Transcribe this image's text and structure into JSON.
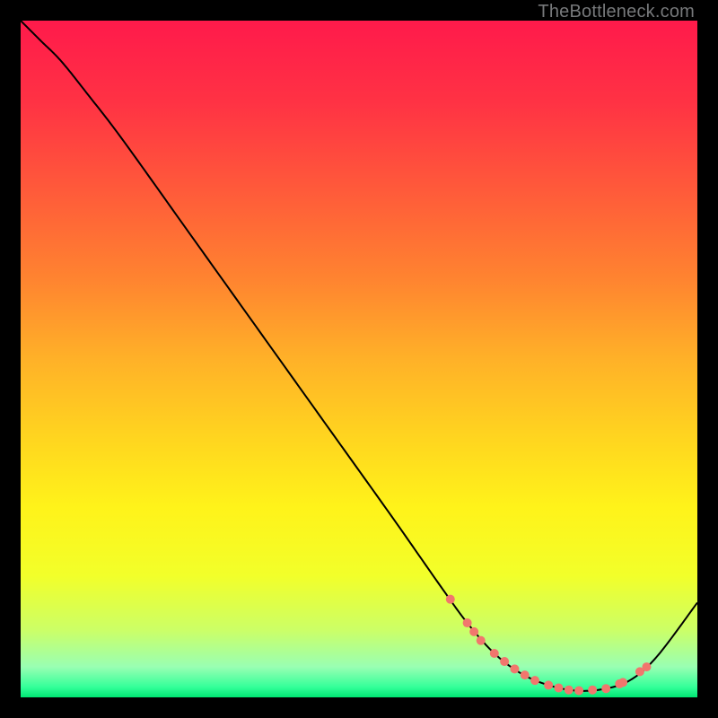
{
  "attribution": "TheBottleneck.com",
  "chart_data": {
    "type": "line",
    "title": "",
    "xlabel": "",
    "ylabel": "",
    "xlim": [
      0,
      100
    ],
    "ylim": [
      0,
      100
    ],
    "background_gradient": {
      "stops": [
        {
          "offset": 0.0,
          "color": "#ff1a4b"
        },
        {
          "offset": 0.12,
          "color": "#ff3244"
        },
        {
          "offset": 0.25,
          "color": "#ff5a3a"
        },
        {
          "offset": 0.38,
          "color": "#ff8330"
        },
        {
          "offset": 0.5,
          "color": "#ffb128"
        },
        {
          "offset": 0.62,
          "color": "#ffd61f"
        },
        {
          "offset": 0.72,
          "color": "#fff31a"
        },
        {
          "offset": 0.82,
          "color": "#f2ff2a"
        },
        {
          "offset": 0.9,
          "color": "#ccff66"
        },
        {
          "offset": 0.955,
          "color": "#99ffb3"
        },
        {
          "offset": 0.985,
          "color": "#33ff99"
        },
        {
          "offset": 1.0,
          "color": "#00e673"
        }
      ]
    },
    "series": [
      {
        "name": "bottleneck-curve",
        "color": "#000000",
        "x": [
          0.0,
          1.0,
          3.0,
          6.0,
          10.0,
          15.0,
          25.0,
          35.0,
          45.0,
          55.0,
          62.0,
          66.0,
          70.0,
          74.0,
          78.0,
          82.0,
          86.0,
          90.0,
          94.0,
          100.0
        ],
        "y": [
          100.0,
          99.0,
          97.0,
          94.0,
          89.0,
          82.5,
          68.5,
          54.5,
          40.5,
          26.5,
          16.5,
          11.0,
          6.5,
          3.5,
          1.8,
          1.0,
          1.2,
          2.5,
          6.0,
          14.0
        ]
      }
    ],
    "markers": {
      "name": "highlight-points",
      "color": "#f1766d",
      "radius": 5,
      "points": [
        {
          "x": 63.5,
          "y": 14.5
        },
        {
          "x": 66.0,
          "y": 11.0
        },
        {
          "x": 67.0,
          "y": 9.7
        },
        {
          "x": 68.0,
          "y": 8.4
        },
        {
          "x": 70.0,
          "y": 6.5
        },
        {
          "x": 71.5,
          "y": 5.3
        },
        {
          "x": 73.0,
          "y": 4.2
        },
        {
          "x": 74.5,
          "y": 3.3
        },
        {
          "x": 76.0,
          "y": 2.5
        },
        {
          "x": 78.0,
          "y": 1.8
        },
        {
          "x": 79.5,
          "y": 1.4
        },
        {
          "x": 81.0,
          "y": 1.1
        },
        {
          "x": 82.5,
          "y": 1.0
        },
        {
          "x": 84.5,
          "y": 1.1
        },
        {
          "x": 86.5,
          "y": 1.3
        },
        {
          "x": 88.5,
          "y": 2.0
        },
        {
          "x": 89.0,
          "y": 2.2
        },
        {
          "x": 91.5,
          "y": 3.8
        },
        {
          "x": 92.5,
          "y": 4.5
        }
      ]
    }
  }
}
